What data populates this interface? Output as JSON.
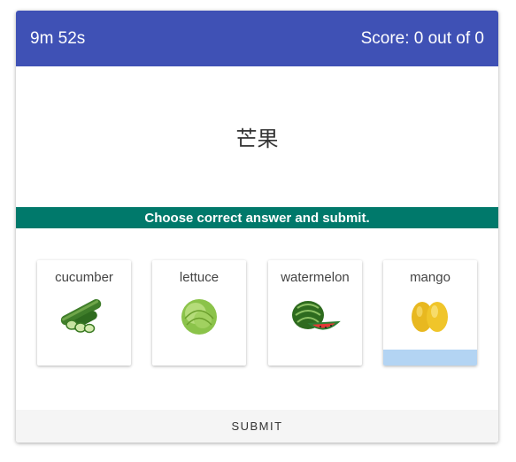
{
  "header": {
    "timer": "9m 52s",
    "score": "Score: 0 out of 0",
    "color": "#3f51b5"
  },
  "question": {
    "prompt": "芒果"
  },
  "instruction": {
    "text": "Choose correct answer and submit.",
    "color": "#00796b"
  },
  "options": [
    {
      "label": "cucumber",
      "icon": "cucumber-icon",
      "selected": false
    },
    {
      "label": "lettuce",
      "icon": "lettuce-icon",
      "selected": false
    },
    {
      "label": "watermelon",
      "icon": "watermelon-icon",
      "selected": false
    },
    {
      "label": "mango",
      "icon": "mango-icon",
      "selected": true
    }
  ],
  "actions": {
    "submit_label": "SUBMIT"
  }
}
